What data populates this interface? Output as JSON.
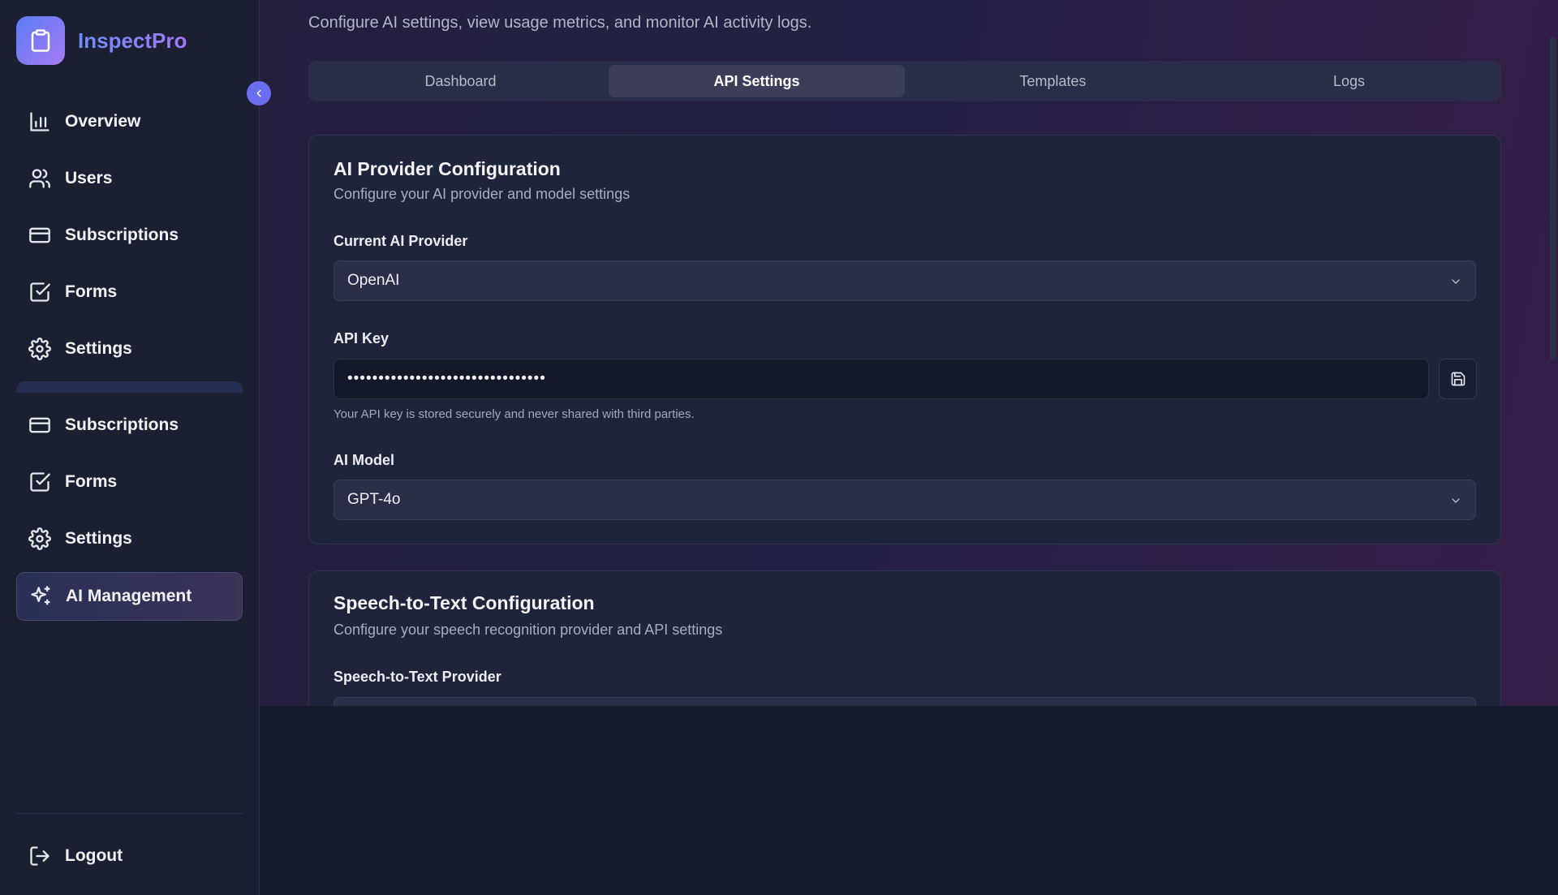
{
  "app": {
    "name": "InspectPro"
  },
  "sidebar": {
    "items": [
      {
        "label": "Overview",
        "icon": "bar-chart-icon"
      },
      {
        "label": "Users",
        "icon": "users-icon"
      },
      {
        "label": "Subscriptions",
        "icon": "credit-card-icon"
      },
      {
        "label": "Forms",
        "icon": "checkbox-icon"
      },
      {
        "label": "Settings",
        "icon": "gear-icon"
      },
      {
        "label": "Subscriptions",
        "icon": "credit-card-icon"
      },
      {
        "label": "Forms",
        "icon": "checkbox-icon"
      },
      {
        "label": "Settings",
        "icon": "gear-icon"
      },
      {
        "label": "AI Management",
        "icon": "sparkles-icon",
        "active": true
      }
    ],
    "logout_label": "Logout"
  },
  "page": {
    "subtitle": "Configure AI settings, view usage metrics, and monitor AI activity logs."
  },
  "tabs": [
    {
      "label": "Dashboard"
    },
    {
      "label": "API Settings",
      "active": true
    },
    {
      "label": "Templates"
    },
    {
      "label": "Logs"
    }
  ],
  "ai_provider_card": {
    "title": "AI Provider Configuration",
    "description": "Configure your AI provider and model settings",
    "provider_label": "Current AI Provider",
    "provider_value": "OpenAI",
    "api_key_label": "API Key",
    "api_key_value": "••••••••••••••••••••••••••••••••",
    "api_key_hint": "Your API key is stored securely and never shared with third parties.",
    "model_label": "AI Model",
    "model_value": "GPT-4o"
  },
  "stt_card": {
    "title": "Speech-to-Text Configuration",
    "description": "Configure your speech recognition provider and API settings",
    "provider_label": "Speech-to-Text Provider"
  },
  "colors": {
    "accent": "#6b6ef0",
    "brand_gradient_start": "#5b7cf6",
    "brand_gradient_end": "#a67af3"
  }
}
